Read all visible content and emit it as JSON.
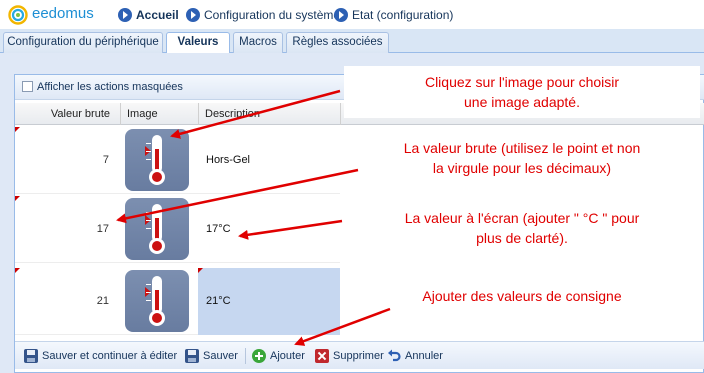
{
  "app": {
    "name": "eedomus"
  },
  "breadcrumb": {
    "items": [
      {
        "label": "Accueil"
      },
      {
        "label": "Configuration du système"
      },
      {
        "label": "Etat (configuration)"
      }
    ]
  },
  "tabs": [
    {
      "label": "Configuration du périphérique",
      "active": false
    },
    {
      "label": "Valeurs",
      "active": true
    },
    {
      "label": "Macros",
      "active": false
    },
    {
      "label": "Règles associées",
      "active": false
    }
  ],
  "toolbar_top": {
    "show_hidden_label": "Afficher les actions masquées",
    "show_hidden_checked": false
  },
  "grid": {
    "columns": [
      "Valeur brute",
      "Image",
      "Description"
    ],
    "rows": [
      {
        "raw_value": "7",
        "image": "thermometer-icon",
        "description": "Hors-Gel",
        "selected": false
      },
      {
        "raw_value": "17",
        "image": "thermometer-icon",
        "description": "17°C",
        "selected": false
      },
      {
        "raw_value": "21",
        "image": "thermometer-icon",
        "description": "21°C",
        "selected": true
      }
    ]
  },
  "bottom_toolbar": {
    "save_continue": "Sauver et continuer à éditer",
    "save": "Sauver",
    "add": "Ajouter",
    "delete": "Supprimer",
    "cancel": "Annuler"
  },
  "annotations": {
    "image_tip": [
      "Cliquez sur l'image pour choisir",
      "une image adapté."
    ],
    "raw_tip": [
      "La valeur brute (utilisez le point et non",
      "la virgule pour les décimaux)"
    ],
    "display_tip": [
      "La valeur à l'écran (ajouter \" °C \" pour",
      "plus de clarté)."
    ],
    "add_tip": [
      "Ajouter des valeurs de consigne"
    ]
  },
  "colors": {
    "annotation": "#e00000",
    "selected_row": "#c6d7f0",
    "accent": "#1e8fd4"
  }
}
